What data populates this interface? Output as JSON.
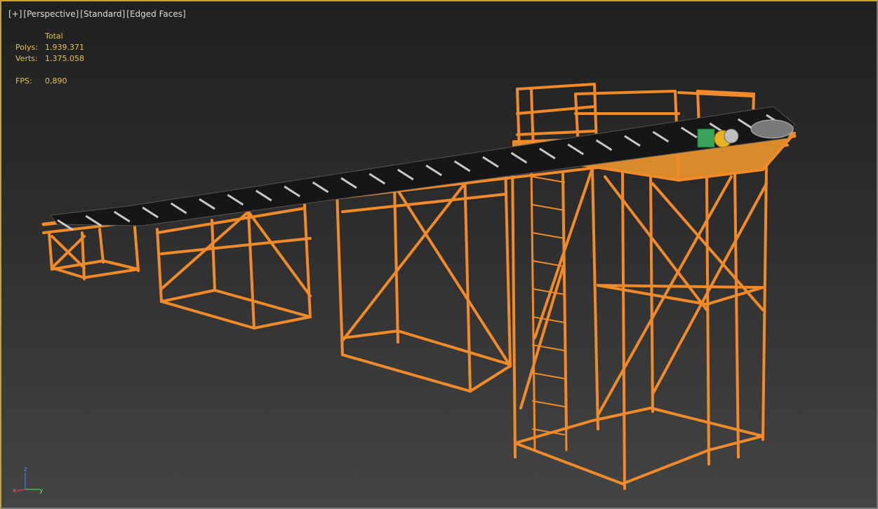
{
  "viewport": {
    "labels": [
      "[+]",
      "[Perspective]",
      "[Standard]",
      "[Edged Faces]"
    ]
  },
  "stats": {
    "header": "Total",
    "polys_label": "Polys:",
    "polys_value": "1.939.371",
    "verts_label": "Verts:",
    "verts_value": "1.375.058",
    "fps_label": "FPS:",
    "fps_value": "0,890"
  },
  "axis": {
    "z": "z",
    "x": "x",
    "y": "y"
  },
  "colors": {
    "frame": "#f08a2a",
    "frame_dark": "#c2601a",
    "belt": "#151515",
    "roller": "#c8c8c8",
    "stats_text": "#e7c34a",
    "label_text": "#dcdcdc",
    "motor_green": "#3aa35a",
    "motor_yellow": "#e7b21f"
  }
}
